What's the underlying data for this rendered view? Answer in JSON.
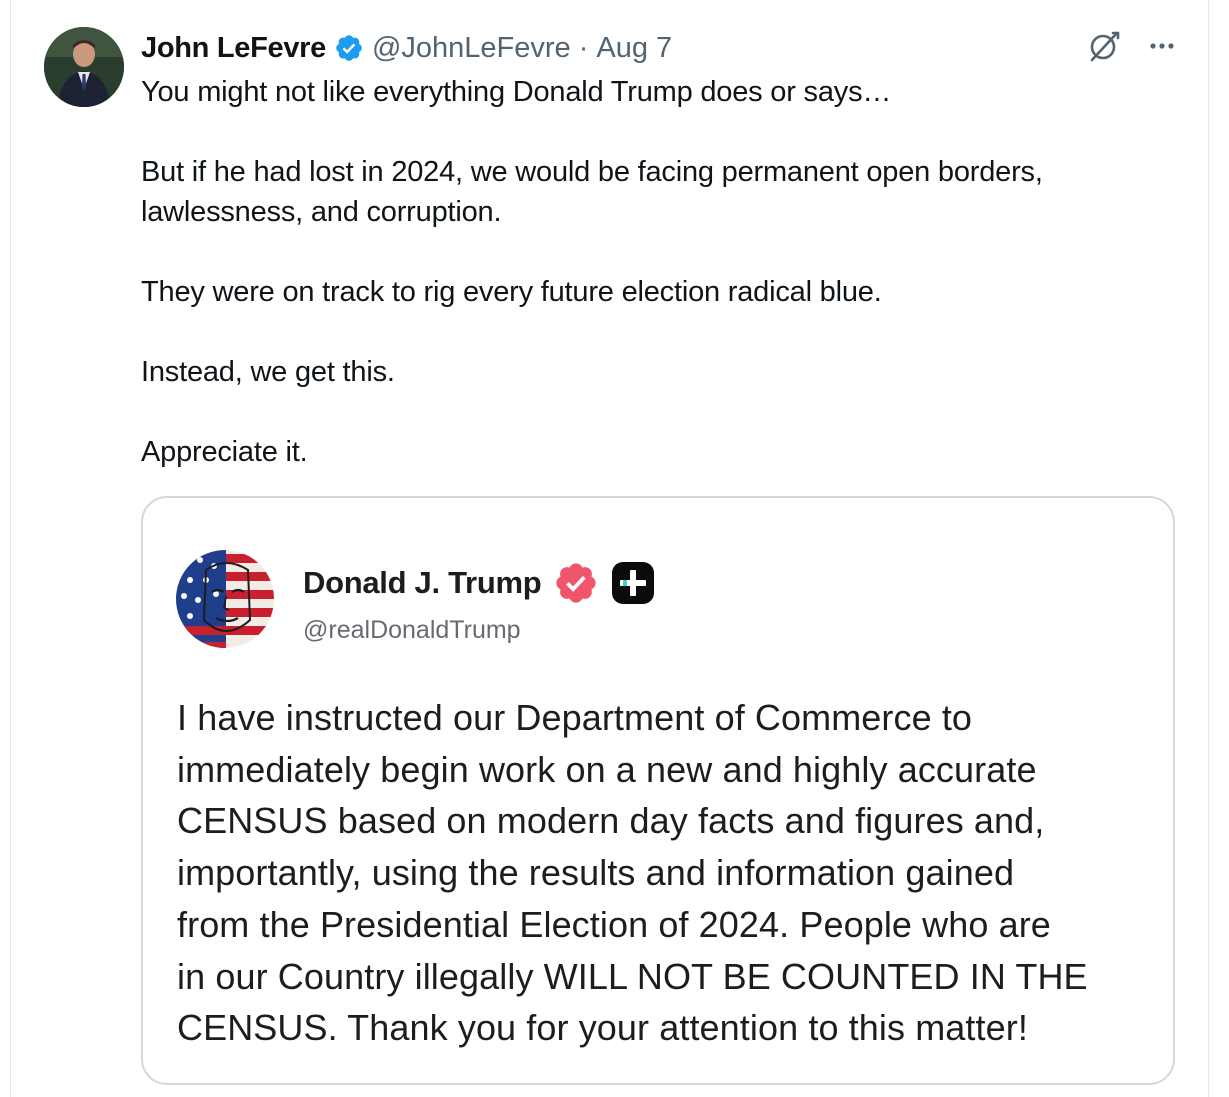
{
  "tweet": {
    "author": {
      "name": "John LeFevre",
      "handle": "@JohnLeFevre",
      "separator": "·",
      "date": "Aug 7"
    },
    "paragraphs": [
      "You might not like everything Donald Trump does or says…",
      "But if he had lost in 2024, we would be facing permanent open borders, lawlessness, and corruption.",
      "They were on track to rig every future election radical blue.",
      "Instead, we get this.",
      "Appreciate it."
    ],
    "icons": {
      "verified": "verified-badge-icon",
      "grok": "grok-icon",
      "more": "more-options-icon"
    },
    "colors": {
      "verified_blue": "#1d9bf0",
      "secondary_text": "#536471",
      "border": "#cfd9de"
    }
  },
  "quoted_post": {
    "name": "Donald J. Trump",
    "handle": "@realDonaldTrump",
    "text_lines": [
      "I have instructed our Department of Commerce to",
      "immediately begin work on a new and highly accurate",
      "CENSUS based on modern day facts and figures and,",
      "importantly, using the results and information gained",
      "from the Presidential Election of 2024. People who are",
      "in our Country illegally WILL NOT BE COUNTED IN THE",
      "CENSUS. Thank you for your attention to this matter!"
    ],
    "icons": {
      "verified": "verified-badge-red-icon",
      "plus": "plus-badge-icon"
    },
    "colors": {
      "verified_red": "#f0556c",
      "plus_badge": "#0b0b0d"
    }
  }
}
